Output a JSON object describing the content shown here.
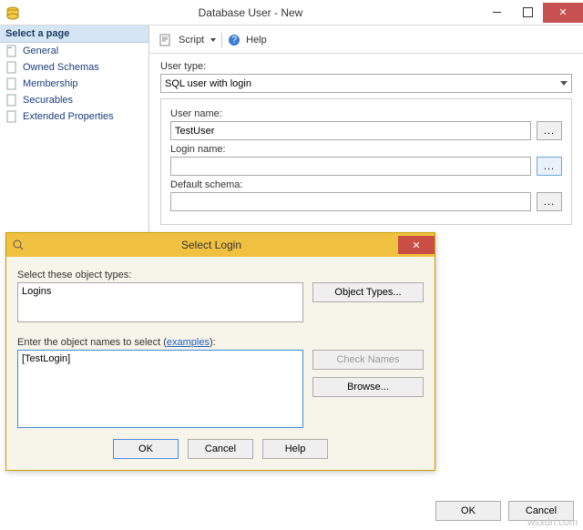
{
  "titlebar": {
    "title": "Database User - New"
  },
  "sidebar": {
    "heading": "Select a page",
    "items": [
      {
        "label": "General"
      },
      {
        "label": "Owned Schemas"
      },
      {
        "label": "Membership"
      },
      {
        "label": "Securables"
      },
      {
        "label": "Extended Properties"
      }
    ]
  },
  "toolbar": {
    "script_label": "Script",
    "help_label": "Help"
  },
  "form": {
    "user_type_label": "User type:",
    "user_type_value": "SQL user with login",
    "user_name_label": "User name:",
    "user_name_value": "TestUser",
    "login_name_label": "Login name:",
    "login_name_value": "",
    "default_schema_label": "Default schema:",
    "default_schema_value": "",
    "ellipsis": "..."
  },
  "footer": {
    "ok_label": "OK",
    "cancel_label": "Cancel"
  },
  "dialog": {
    "title": "Select Login",
    "types_label": "Select these object types:",
    "types_value": "Logins",
    "object_types_btn": "Object Types...",
    "names_label_prefix": "Enter the object names to select (",
    "names_label_link": "examples",
    "names_label_suffix": "):",
    "names_value": "[TestLogin]",
    "check_names_btn": "Check Names",
    "browse_btn": "Browse...",
    "ok_label": "OK",
    "cancel_label": "Cancel",
    "help_label": "Help"
  },
  "watermark": "wsxdn.com"
}
